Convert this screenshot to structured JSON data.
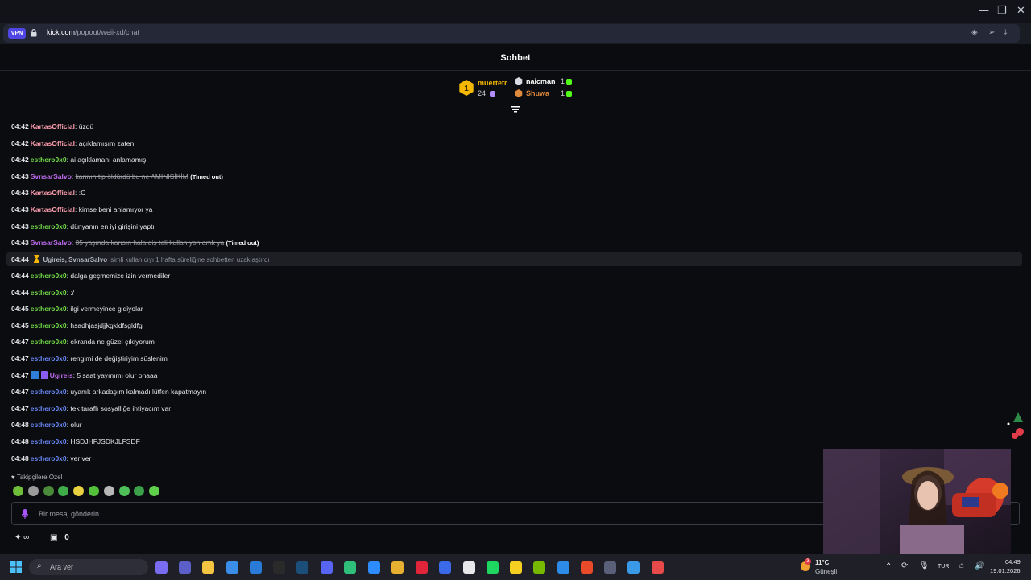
{
  "browser": {
    "vpn_label": "VPN",
    "url_host": "kick.com",
    "url_path": "/popout/weii-xd/chat"
  },
  "chat": {
    "title": "Sohbet",
    "leaderboard": {
      "first": {
        "rank": "1",
        "name": "muertetr",
        "count": "24"
      },
      "second": {
        "name": "naicman",
        "count": "1"
      },
      "third": {
        "name": "Shuwa",
        "count": "1"
      }
    },
    "messages": [
      {
        "time": "04:42",
        "user": "KartasOfficial",
        "user_color": "#ff9fb0",
        "text": "üzdü"
      },
      {
        "time": "04:42",
        "user": "KartasOfficial",
        "user_color": "#ff9fb0",
        "text": "açıklamışım zaten"
      },
      {
        "time": "04:42",
        "user": "esthero0x0",
        "user_color": "#74e04a",
        "text": "ai açıklamanı anlamamış"
      },
      {
        "time": "04:43",
        "user": "SvnsarSalvo",
        "user_color": "#c06cf0",
        "text": "karının tip öldürdü bu ne AMINISİKİM",
        "struck": true,
        "suffix": "(Timed out)"
      },
      {
        "time": "04:43",
        "user": "KartasOfficial",
        "user_color": "#ff9fb0",
        "text": ":C"
      },
      {
        "time": "04:43",
        "user": "KartasOfficial",
        "user_color": "#ff9fb0",
        "text": "kimse beni anlamıyor ya"
      },
      {
        "time": "04:43",
        "user": "esthero0x0",
        "user_color": "#74e04a",
        "text": "dünyanın en iyi girişini yaptı"
      },
      {
        "time": "04:43",
        "user": "SvnsarSalvo",
        "user_color": "#c06cf0",
        "text": "35 yaşında karısın hala diş teli kullanıyon amk ya",
        "struck": true,
        "suffix": "(Timed out)"
      }
    ],
    "system": {
      "time": "04:44",
      "users": "Ugireis, SvnsarSalvo",
      "text": "isimli kullanıcıyı 1 hafta süreliğine sohbetten uzaklaştırdı"
    },
    "messages2": [
      {
        "time": "04:44",
        "user": "esthero0x0",
        "user_color": "#74e04a",
        "text": "dalga geçmemize izin vermediler"
      },
      {
        "time": "04:44",
        "user": "esthero0x0",
        "user_color": "#74e04a",
        "text": ":/"
      },
      {
        "time": "04:45",
        "user": "esthero0x0",
        "user_color": "#74e04a",
        "text": "ilgi vermeyince gidiyolar"
      },
      {
        "time": "04:45",
        "user": "esthero0x0",
        "user_color": "#74e04a",
        "text": "hsadhjasjdjjkgkldfsgldfg"
      },
      {
        "time": "04:47",
        "user": "esthero0x0",
        "user_color": "#74e04a",
        "text": "ekranda ne güzel çıkıyorum"
      },
      {
        "time": "04:47",
        "user": "esthero0x0",
        "user_color": "#6b8cff",
        "text": "rengimi de değiştiriyim süslenim"
      },
      {
        "time": "04:47",
        "user": "Ugireis",
        "user_color": "#c06cf0",
        "text": "5 saat yayınımı olur ohaaa",
        "badges": true
      },
      {
        "time": "04:47",
        "user": "esthero0x0",
        "user_color": "#6b8cff",
        "text": "uyanık arkadaşım kalmadı lütfen kapatmayın"
      },
      {
        "time": "04:47",
        "user": "esthero0x0",
        "user_color": "#6b8cff",
        "text": "tek taraflı sosyalliğe ihtiyacım var"
      },
      {
        "time": "04:48",
        "user": "esthero0x0",
        "user_color": "#6b8cff",
        "text": "olur"
      },
      {
        "time": "04:48",
        "user": "esthero0x0",
        "user_color": "#6b8cff",
        "text": "HSDJHFJSDKJLFSDF"
      },
      {
        "time": "04:48",
        "user": "esthero0x0",
        "user_color": "#6b8cff",
        "text": "ver ver"
      }
    ],
    "followers_label": "Takipçilere Özel",
    "input_placeholder": "Bir mesaj gönderin",
    "bottom": {
      "infinity": "∞",
      "count": "0"
    }
  },
  "taskbar": {
    "search_placeholder": "Ara ver",
    "weather_temp": "11°C",
    "weather_desc": "Güneşli",
    "weather_badge": "3",
    "lang": "TUR",
    "time": "04:49",
    "date": "19.01.2026"
  },
  "colors": {
    "accent_green": "#53fc18",
    "gold": "#f5b700"
  }
}
